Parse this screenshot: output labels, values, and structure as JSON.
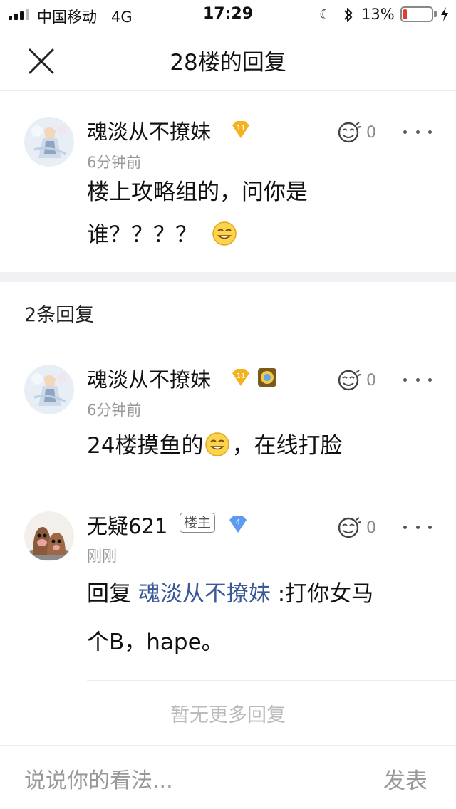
{
  "status": {
    "carrier": "中国移动",
    "network": "4G",
    "time": "17:29",
    "battery": "13%",
    "battery_level": 0.13
  },
  "header": {
    "title": "28楼的回复"
  },
  "main_post": {
    "username": "魂淡从不撩妹",
    "level": "11",
    "time": "6分钟前",
    "likes": "0",
    "text_line1": "楼上攻略组的，问你是",
    "text_line2": "谁？？？？"
  },
  "replies_title": "2条回复",
  "replies": [
    {
      "username": "魂淡从不撩妹",
      "level": "11",
      "time": "6分钟前",
      "likes": "0",
      "text_a": "24楼摸鱼的",
      "text_b": "，在线打脸"
    },
    {
      "username": "无疑621",
      "tag": "楼主",
      "level": "4",
      "time": "刚刚",
      "likes": "0",
      "reply_prefix": "回复 ",
      "reply_target": "魂淡从不撩妹",
      "reply_text_a": " :打你女马",
      "reply_text_b": "个B，hape。"
    }
  ],
  "no_more": "暂无更多回复",
  "composer": {
    "placeholder": "说说你的看法...",
    "send": "发表"
  },
  "colors": {
    "battery_fill": "#e53935",
    "gold_badge": "#f5b21f",
    "blue_badge": "#5b9bf0",
    "link": "#3b5998"
  }
}
